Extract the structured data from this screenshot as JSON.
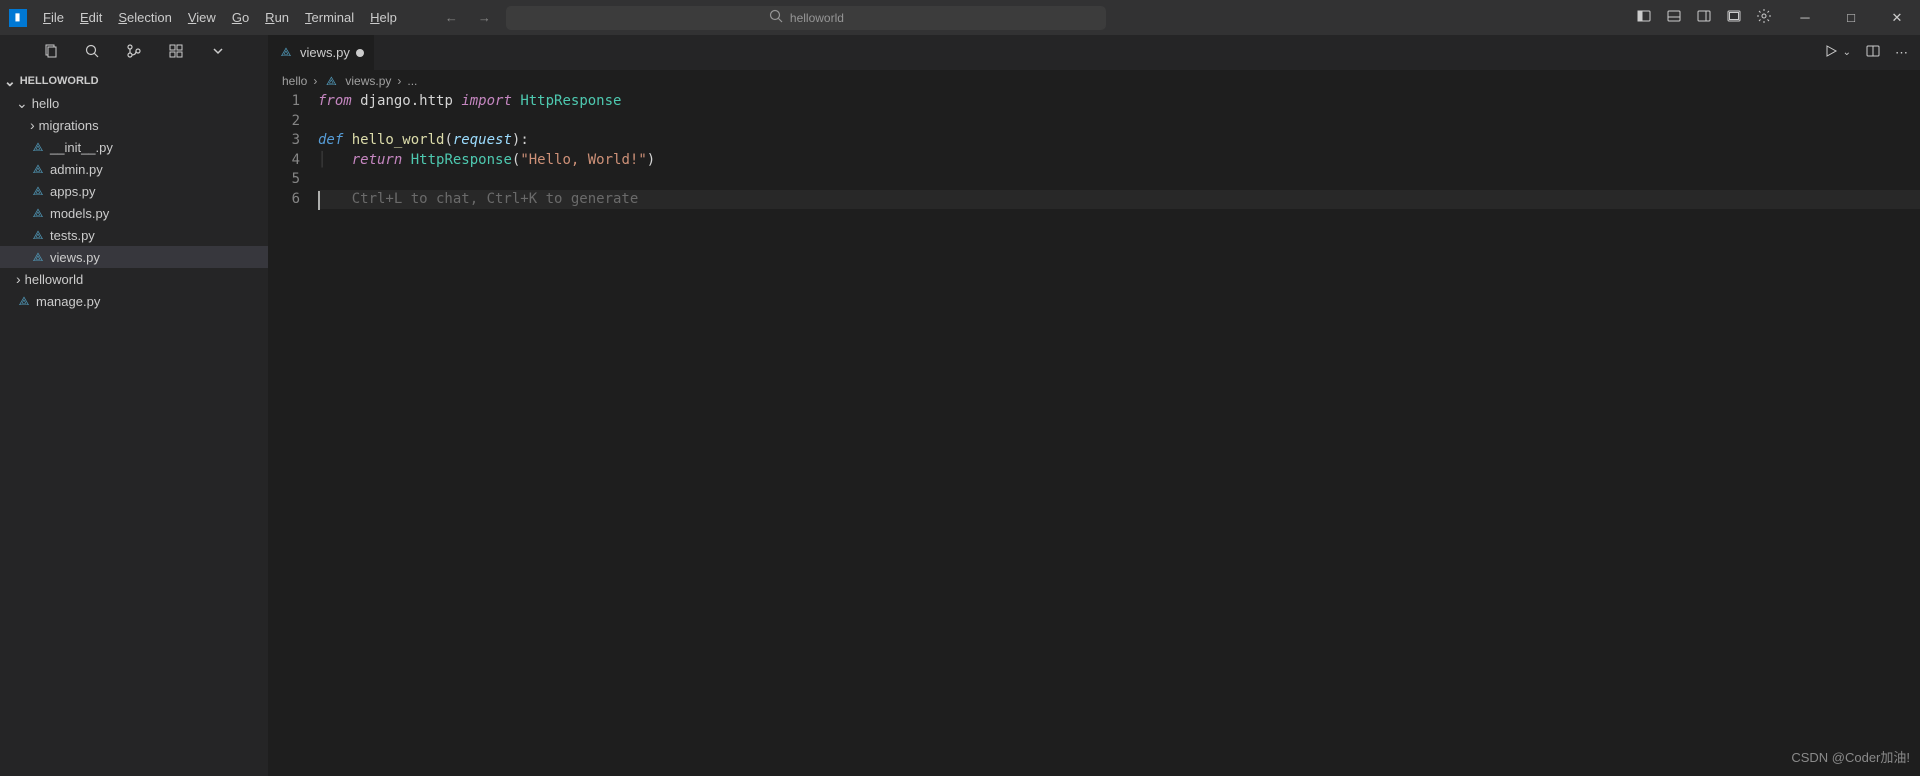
{
  "menu": {
    "items": [
      "File",
      "Edit",
      "Selection",
      "View",
      "Go",
      "Run",
      "Terminal",
      "Help"
    ]
  },
  "search": {
    "text": "helloworld"
  },
  "sidebar": {
    "header": "HELLOWORLD",
    "tree": [
      {
        "label": "hello",
        "type": "folder-open",
        "indent": 16
      },
      {
        "label": "migrations",
        "type": "folder-closed",
        "indent": 30
      },
      {
        "label": "__init__.py",
        "type": "py",
        "indent": 30
      },
      {
        "label": "admin.py",
        "type": "py",
        "indent": 30
      },
      {
        "label": "apps.py",
        "type": "py",
        "indent": 30
      },
      {
        "label": "models.py",
        "type": "py",
        "indent": 30
      },
      {
        "label": "tests.py",
        "type": "py",
        "indent": 30
      },
      {
        "label": "views.py",
        "type": "py",
        "indent": 30,
        "selected": true
      },
      {
        "label": "helloworld",
        "type": "folder-closed",
        "indent": 16
      },
      {
        "label": "manage.py",
        "type": "py",
        "indent": 16
      }
    ]
  },
  "tab": {
    "filename": "views.py"
  },
  "breadcrumb": {
    "parts": [
      "hello",
      "views.py",
      "..."
    ]
  },
  "code": {
    "lines": [
      {
        "n": 1,
        "segments": [
          {
            "t": "from ",
            "c": "kw-import"
          },
          {
            "t": "django.http ",
            "c": "module"
          },
          {
            "t": "import ",
            "c": "kw-import"
          },
          {
            "t": "HttpResponse",
            "c": "classname"
          }
        ]
      },
      {
        "n": 2,
        "segments": []
      },
      {
        "n": 3,
        "segments": [
          {
            "t": "def ",
            "c": "kw-def"
          },
          {
            "t": "hello_world",
            "c": "func-name"
          },
          {
            "t": "(",
            "c": "punct"
          },
          {
            "t": "request",
            "c": "param"
          },
          {
            "t": "):",
            "c": "punct"
          }
        ]
      },
      {
        "n": 4,
        "segments": [
          {
            "t": "│   ",
            "c": "indent-guide"
          },
          {
            "t": "return ",
            "c": "kw-import"
          },
          {
            "t": "HttpResponse",
            "c": "classname"
          },
          {
            "t": "(",
            "c": "punct"
          },
          {
            "t": "\"Hello, World!\"",
            "c": "string"
          },
          {
            "t": ")",
            "c": "punct"
          }
        ]
      },
      {
        "n": 5,
        "segments": []
      },
      {
        "n": 6,
        "current": true,
        "hint": "Ctrl+L to chat, Ctrl+K to generate"
      }
    ]
  },
  "watermark": "CSDN @Coder加油!"
}
